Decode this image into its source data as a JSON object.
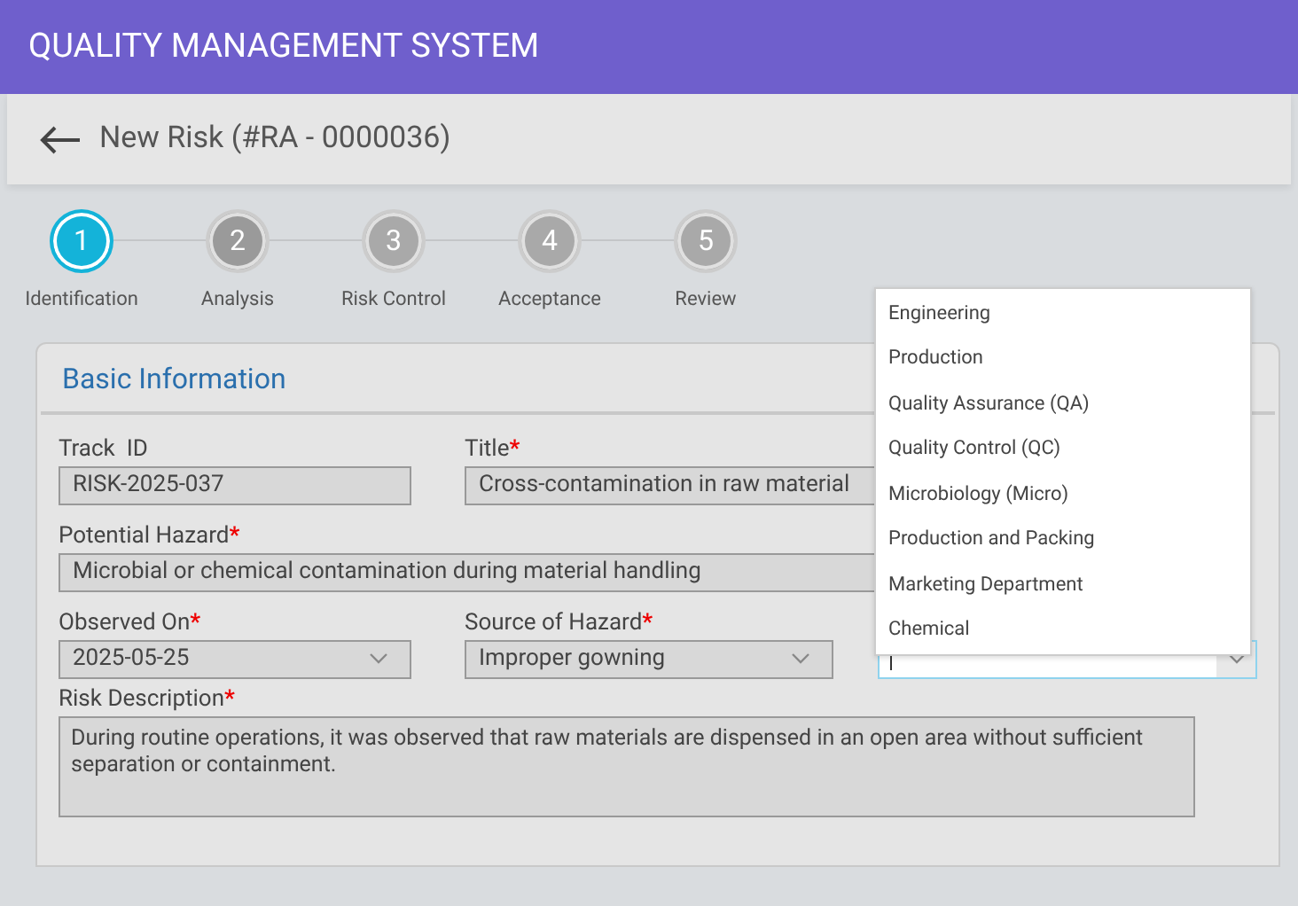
{
  "app_title": "QUALITY MANAGEMENT SYSTEM",
  "page_title": "New Risk (#RA - 0000036)",
  "steps": [
    {
      "number": "1",
      "label": "Identification",
      "selected": true,
      "completed": false
    },
    {
      "number": "2",
      "label": "Analysis",
      "selected": false,
      "completed": true
    },
    {
      "number": "3",
      "label": "Risk Control",
      "selected": false,
      "completed": false
    },
    {
      "number": "4",
      "label": "Acceptance",
      "selected": false,
      "completed": false
    },
    {
      "number": "5",
      "label": "Review",
      "selected": false,
      "completed": false
    }
  ],
  "section_title": "Basic Information",
  "fields": {
    "track_id": {
      "label": "Track  ID",
      "value": "RISK-2025-037"
    },
    "title": {
      "label": "Title",
      "required_mark": "*",
      "value": "Cross-contamination in raw material"
    },
    "potential_hazard": {
      "label": "Potential Hazard",
      "required_mark": "*",
      "value": "Microbial or chemical contamination during material handling"
    },
    "observed_on": {
      "label": "Observed On",
      "required_mark": "*",
      "value": "2025-05-25"
    },
    "source_of_hazard": {
      "label": "Source of Hazard",
      "required_mark": "*",
      "value": "Improper gowning"
    },
    "department": {
      "focused": true
    },
    "risk_description": {
      "label": "Risk Description",
      "required_mark": "*",
      "value": "During routine operations, it was observed that raw materials are dispensed in an open area without sufficient separation or containment."
    }
  },
  "dropdown_options": [
    "Engineering",
    "Production",
    "Quality Assurance (QA)",
    "Quality Control (QC)",
    "Microbiology (Micro)",
    "Production and Packing",
    "Marketing Department",
    "Chemical"
  ]
}
